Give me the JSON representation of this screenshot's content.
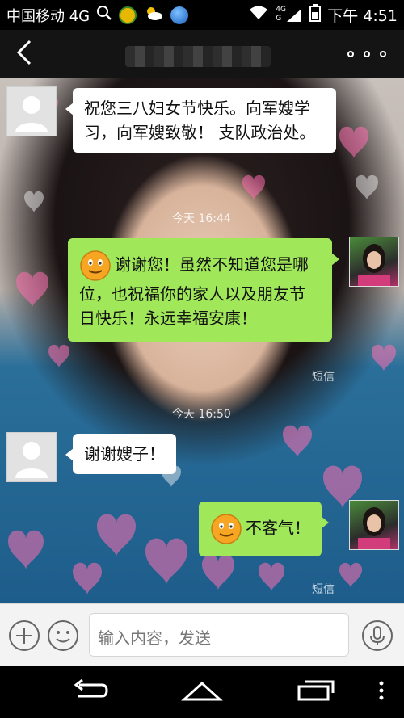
{
  "status_bar": {
    "carrier": "中国移动 4G",
    "time": "下午 4:51",
    "network": "4G",
    "network_g": "G"
  },
  "chat": {
    "messages": [
      {
        "side": "received",
        "text": "祝您三八妇女节快乐。向军嫂学习，向军嫂致敬！  支队政治处。"
      },
      {
        "side": "sent",
        "text": "谢谢您！虽然不知道您是哪位，也祝福你的家人以及朋友节日快乐！永远幸福安康！"
      },
      {
        "side": "received",
        "text": "谢谢嫂子！"
      },
      {
        "side": "sent",
        "text": "不客气！"
      }
    ],
    "timestamps": [
      "今天 16:44",
      "今天 16:50"
    ],
    "sms_tag": "短信"
  },
  "input_bar": {
    "placeholder": "输入内容，发送"
  },
  "colors": {
    "sent_bubble": "#a0e75a",
    "received_bubble": "#ffffff",
    "title_bar": "#141414"
  }
}
